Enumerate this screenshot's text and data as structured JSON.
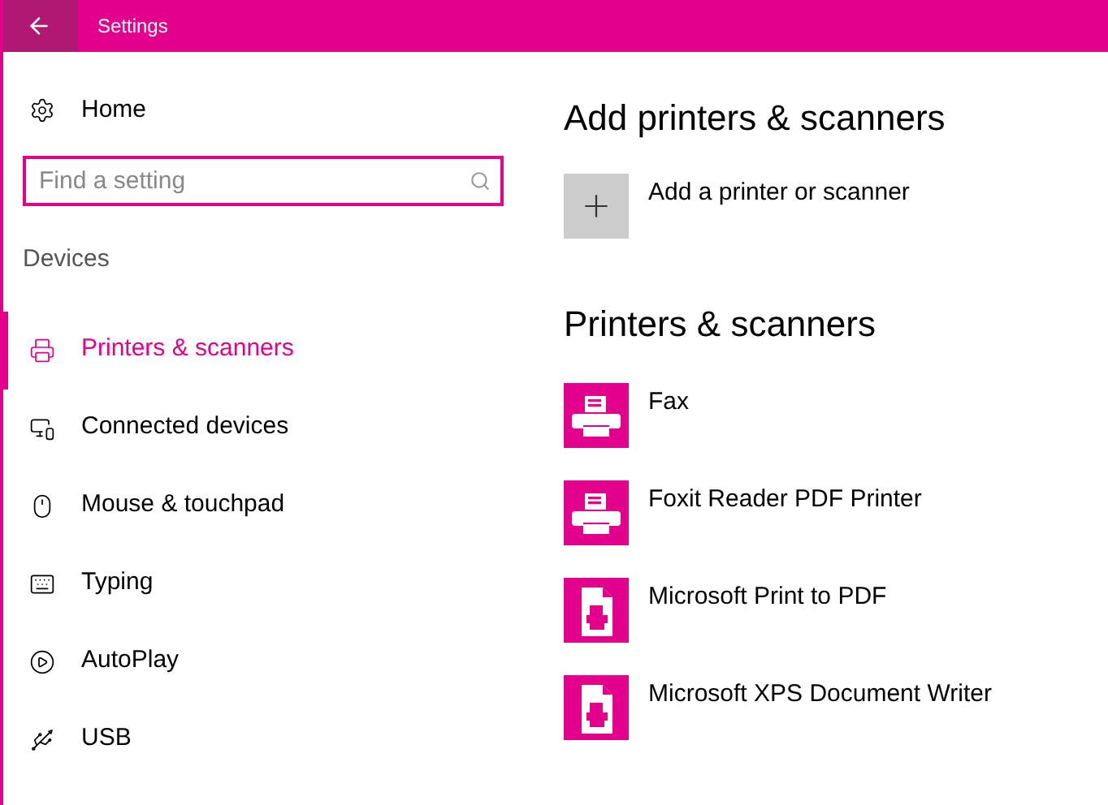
{
  "window": {
    "title": "Settings"
  },
  "sidebar": {
    "home": "Home",
    "search": {
      "placeholder": "Find a setting"
    },
    "section": "Devices",
    "items": [
      {
        "kind": "printer",
        "label": "Printers & scanners",
        "selected": true
      },
      {
        "kind": "connected",
        "label": "Connected devices",
        "selected": false
      },
      {
        "kind": "mouse",
        "label": "Mouse & touchpad",
        "selected": false
      },
      {
        "kind": "keyboard",
        "label": "Typing",
        "selected": false
      },
      {
        "kind": "autoplay",
        "label": "AutoPlay",
        "selected": false
      },
      {
        "kind": "usb",
        "label": "USB",
        "selected": false
      }
    ]
  },
  "add_section": {
    "title": "Add printers & scanners",
    "button": "Add a printer or scanner"
  },
  "printers_section": {
    "title": "Printers & scanners",
    "items": [
      {
        "kind": "printer",
        "name": "Fax"
      },
      {
        "kind": "printer",
        "name": "Foxit Reader PDF Printer"
      },
      {
        "kind": "document",
        "name": "Microsoft Print to PDF"
      },
      {
        "kind": "document",
        "name": "Microsoft XPS Document Writer"
      }
    ]
  }
}
